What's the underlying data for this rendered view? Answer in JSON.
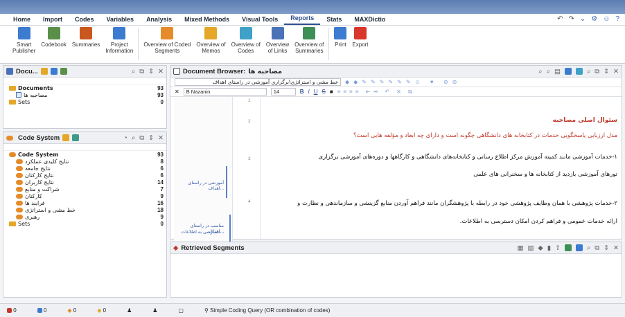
{
  "ribbon_tabs": [
    "Home",
    "Import",
    "Codes",
    "Variables",
    "Analysis",
    "Mixed Methods",
    "Visual Tools",
    "Reports",
    "Stats",
    "MAXDictio"
  ],
  "active_tab": "Reports",
  "ribbon_commands": [
    {
      "label": "Smart\nPublisher",
      "color": "#3b7bd0"
    },
    {
      "label": "Codebook",
      "color": "#5a8f4a"
    },
    {
      "label": "Summaries",
      "color": "#c9571e"
    },
    {
      "label": "Project\nInformation",
      "color": "#3b7bd0"
    },
    {
      "label": "Overview of Coded\nSegments",
      "color": "#e58b2a"
    },
    {
      "label": "Overview of\nMemos",
      "color": "#e5a728"
    },
    {
      "label": "Overview of\nCodes",
      "color": "#3fa0c8"
    },
    {
      "label": "Overview\nof Links",
      "color": "#4b72b8"
    },
    {
      "label": "Overview of\nSummaries",
      "color": "#3e8f56"
    },
    {
      "label": "Print",
      "color": "#3b7bd0"
    },
    {
      "label": "Export",
      "color": "#d9372b"
    }
  ],
  "doc_pane": {
    "title": "Docu...",
    "rows": [
      {
        "label": "Documents",
        "count": "93"
      },
      {
        "label": "مصاحبه ها",
        "count": "93"
      },
      {
        "label": "Sets",
        "count": "0"
      }
    ]
  },
  "code_pane": {
    "title": "Code System",
    "rows": [
      {
        "label": "Code System",
        "count": "93"
      },
      {
        "label": "نتایج کلیدی عملکرد",
        "count": "8"
      },
      {
        "label": "نتایج جامعه",
        "count": "6"
      },
      {
        "label": "نتایج کارکنان",
        "count": "6"
      },
      {
        "label": "نتایج کاربران",
        "count": "14"
      },
      {
        "label": "شراکت و منابع",
        "count": "7"
      },
      {
        "label": "کارکنان",
        "count": "9"
      },
      {
        "label": "فرایند ها",
        "count": "16"
      },
      {
        "label": "خط مشی و استراتژی",
        "count": "18"
      },
      {
        "label": "رهبری",
        "count": "9"
      },
      {
        "label": "Sets",
        "count": "0"
      }
    ]
  },
  "doc_browser": {
    "title": "Document Browser:",
    "doc_name": "مصاحبه ها",
    "code_combo": "خط مشی و استراتژی\\برگزاری آموزشی در راستای اهداف",
    "font_name": "B Nazanin",
    "font_size": "14",
    "lines": [
      {
        "num": "1",
        "text": "سئوال اصلی مصاحبه",
        "color": "#c0392b"
      },
      {
        "num": "2",
        "text": "مدل ارزیابی پاسخگویی خدمات در کتابخانه های دانشگاهی چگونه است و دارای چه ابعاد و مؤلفه هایی است؟",
        "color": "#c0392b"
      },
      {
        "num": "3",
        "text": "۱-خدمات آموزشی مانند کمیته آموزش مرکز اطلاع رسانی و کتابخانه‌های دانشگاهی و کارگاهها و دوره‌های آموزشی برگزاری",
        "color": "#111"
      },
      {
        "num": "",
        "text": "تورهای آموزشی بازدید از کتابخانه ها و سخنرانی های علمی",
        "color": "#111"
      },
      {
        "num": "4",
        "text": "۲-خدمات پژوهشی با همان وظایف پژوهشی خود در رابطه با پژوهشگران مانند فراهم آوردن منابع گزینشی و سازماندهی و نظارت و",
        "color": "#111"
      },
      {
        "num": "",
        "text": "ارائه خدمات عمومی و فراهم کردن امکان دسترسی به اطلاعات.",
        "color": "#111"
      }
    ],
    "code_labels": [
      "آموزشی در راستای اهداف...",
      "مناسب در راستای اهداف...",
      "دسترسی به اطلاعات..."
    ]
  },
  "retrieved": {
    "title": "Retrieved Segments"
  },
  "status": {
    "counts": [
      "0",
      "0",
      "0",
      "0"
    ],
    "query": "Simple Coding Query (OR combination of codes)"
  }
}
